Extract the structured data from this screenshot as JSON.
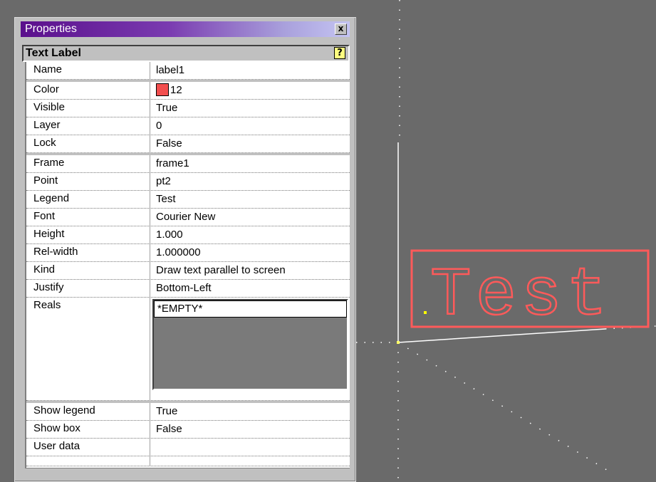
{
  "window": {
    "title": "Properties",
    "close_glyph": "x"
  },
  "panel": {
    "title": "Text Label",
    "help_icon": "help-icon"
  },
  "rows": [
    {
      "name": "Name",
      "value": "label1"
    },
    {
      "name": "Color",
      "value": "12",
      "swatch": "#f24e4e"
    },
    {
      "name": "Visible",
      "value": "True"
    },
    {
      "name": "Layer",
      "value": "0"
    },
    {
      "name": "Lock",
      "value": "False"
    },
    {
      "name": "Frame",
      "value": "frame1"
    },
    {
      "name": "Point",
      "value": "pt2"
    },
    {
      "name": "Legend",
      "value": "Test"
    },
    {
      "name": "Font",
      "value": "Courier New"
    },
    {
      "name": "Height",
      "value": "1.000"
    },
    {
      "name": "Rel-width",
      "value": "1.000000"
    },
    {
      "name": "Kind",
      "value": "Draw text parallel to screen"
    },
    {
      "name": "Justify",
      "value": "Bottom-Left"
    },
    {
      "name": "Reals",
      "items": [
        "*EMPTY*"
      ]
    },
    {
      "name": "Show legend",
      "value": "True"
    },
    {
      "name": "Show box",
      "value": "False"
    },
    {
      "name": "User data",
      "value": ""
    }
  ],
  "canvas": {
    "label_text": "Test",
    "label_color": "#ff5a5a",
    "axis_color": "#ffffff",
    "point_color": "#ffff00",
    "background": "#6a6a6a"
  }
}
